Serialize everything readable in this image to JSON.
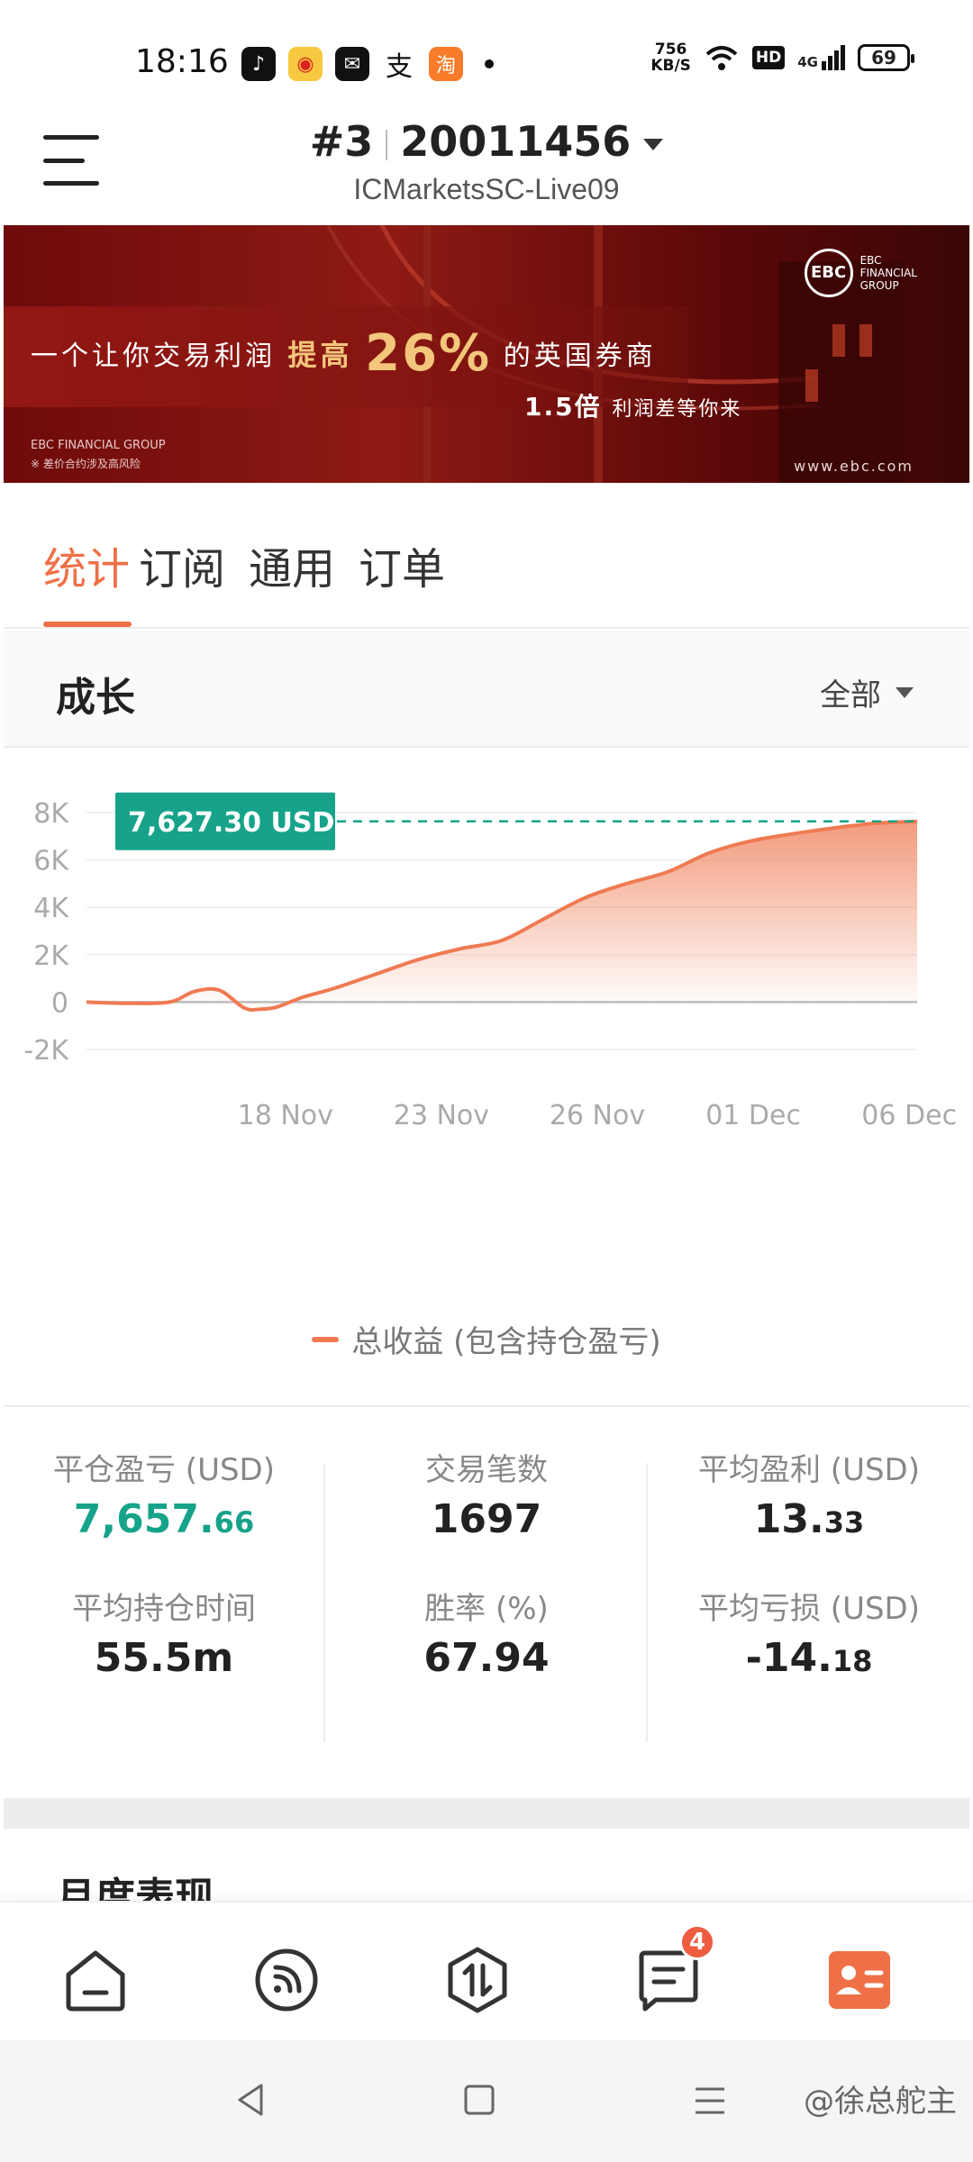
{
  "status_bar": {
    "time": "18:16",
    "net_speed_value": "756",
    "net_speed_unit": "KB/S",
    "hd": "HD",
    "network": "4G",
    "battery": "69"
  },
  "header": {
    "account_index": "#3",
    "account_number": "20011456",
    "server": "ICMarketsSC-Live09"
  },
  "banner": {
    "text_prefix": "一个让你交易利润",
    "text_highlight": "提高",
    "text_percent": "26%",
    "text_suffix": "的英国券商",
    "line2_bold": "1.5倍",
    "line2_rest": "利润差等你来",
    "brand_short": "EBC",
    "brand_line1": "EBC",
    "brand_line2": "FINANCIAL",
    "brand_line3": "GROUP",
    "footer1": "EBC FINANCIAL GROUP",
    "footer2": "※ 差价合约涉及高风险",
    "url": "www.ebc.com"
  },
  "tabs": [
    "统计",
    "订阅",
    "通用",
    "订单"
  ],
  "growth": {
    "title": "成长",
    "filter": "全部"
  },
  "chart_data": {
    "type": "area",
    "current_value_label": "7,627.30 USD",
    "y_ticks": [
      "8K",
      "6K",
      "4K",
      "2K",
      "0",
      "-2K"
    ],
    "x_ticks": [
      "18 Nov",
      "23 Nov",
      "26 Nov",
      "01 Dec",
      "06 Dec"
    ],
    "ylim": [
      -2000,
      8000
    ],
    "series": [
      {
        "name": "总收益 (包含持仓盈亏)",
        "x": [
          0,
          0.05,
          0.1,
          0.13,
          0.16,
          0.19,
          0.21,
          0.23,
          0.26,
          0.3,
          0.35,
          0.4,
          0.45,
          0.5,
          0.55,
          0.6,
          0.65,
          0.7,
          0.75,
          0.8,
          0.85,
          0.9,
          0.95,
          1.0
        ],
        "values": [
          0,
          -50,
          0,
          450,
          500,
          -250,
          -300,
          -200,
          200,
          600,
          1200,
          1800,
          2250,
          2600,
          3500,
          4400,
          5000,
          5500,
          6300,
          6800,
          7100,
          7350,
          7550,
          7627.3
        ]
      }
    ],
    "accent_line": "#ef7a52",
    "label_bg": "#16a38a",
    "dash_color": "#16a38a"
  },
  "legend": {
    "label": "总收益 (包含持仓盈亏)"
  },
  "stats": {
    "closed_pnl_label": "平仓盈亏 (USD)",
    "closed_pnl_int": "7,657.",
    "closed_pnl_dec": "66",
    "trades_label": "交易笔数",
    "trades_value": "1697",
    "avg_profit_label": "平均盈利 (USD)",
    "avg_profit_int": "13.",
    "avg_profit_dec": "33",
    "avg_hold_label": "平均持仓时间",
    "avg_hold_value": "55.5m",
    "win_rate_label": "胜率 (%)",
    "win_rate_value": "67.94",
    "avg_loss_label": "平均亏损 (USD)",
    "avg_loss_int": "-14.",
    "avg_loss_dec": "18"
  },
  "monthly": {
    "title": "月度表现"
  },
  "bottom_nav": {
    "messages_badge": "4"
  },
  "watermark": "@徐总舵主",
  "colors": {
    "accent": "#ef7047",
    "positive": "#16a38a"
  }
}
